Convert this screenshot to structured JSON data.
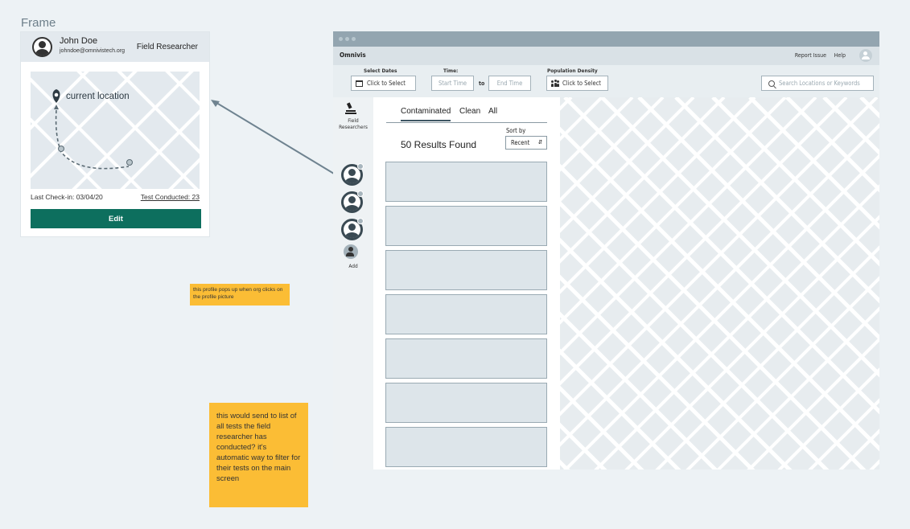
{
  "frame_label": "Frame",
  "profile": {
    "name": "John Doe",
    "email": "johndoe@omnivistech.org",
    "role": "Field Researcher",
    "map_label": "current location",
    "last_checkin": "Last Check-in: 03/04/20",
    "tests_conducted": "Test Conducted: 23",
    "edit_label": "Edit"
  },
  "notes": {
    "profile_popup": "this profile pops up when org clicks on the profile picture",
    "tests_link": "this would send to list of all tests the field researcher has conducted? it's automatic way to filter for their tests on the main screen"
  },
  "app": {
    "brand": "Omnivis",
    "report_issue": "Report Issue",
    "help": "Help",
    "filters": {
      "dates_label": "Select Dates",
      "dates_value": "Click to Select",
      "time_label": "Time:",
      "start_placeholder": "Start Time",
      "to": "to",
      "end_placeholder": "End Time",
      "density_label": "Population Density",
      "density_value": "Click to Select",
      "search_placeholder": "Search Locations or Keywords"
    },
    "sidebar": {
      "field_researchers": "Field Researchers",
      "add": "Add"
    },
    "list": {
      "tabs": [
        "Contaminated",
        "Clean",
        "All"
      ],
      "results": "50 Results Found",
      "sort_by": "Sort by",
      "sort_value": "Recent"
    }
  },
  "colors": {
    "accent": "#0d6f5e",
    "note": "#fbbd35",
    "titlebar": "#93a5b0"
  }
}
